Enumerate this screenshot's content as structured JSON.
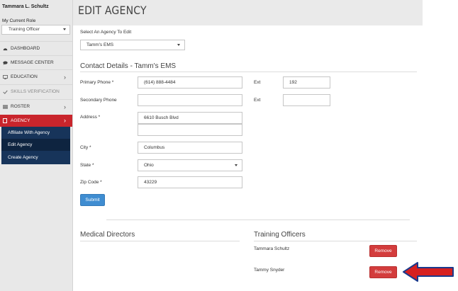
{
  "sidebar": {
    "user_name": "Tammara L. Schultz",
    "role_label": "My Current Role",
    "role_value": "Training Officer",
    "nav": {
      "dashboard": "DASHBOARD",
      "message_center": "MESSAGE CENTER",
      "education": "EDUCATION",
      "skills_verification": "SKILLS VERIFICATION",
      "roster": "ROSTER",
      "agency": "AGENCY"
    },
    "agency_sub": {
      "affiliate": "Affiliate With Agency",
      "edit": "Edit Agency",
      "create": "Create Agency"
    }
  },
  "header": {
    "title": "EDIT AGENCY"
  },
  "agency_select": {
    "label": "Select An Agency To Edit",
    "value": "Tamm's EMS"
  },
  "contact": {
    "title": "Contact Details - Tamm's EMS",
    "primary_phone_label": "Primary Phone *",
    "primary_phone": "(614) 888-4484",
    "ext_label": "Ext",
    "ext_value": "192",
    "secondary_phone_label": "Secondary Phone",
    "secondary_phone": "",
    "secondary_ext": "",
    "address_label": "Address *",
    "address1": "6610 Busch Blvd",
    "address2": "",
    "city_label": "City *",
    "city": "Columbus",
    "state_label": "State *",
    "state": "Ohio",
    "zip_label": "Zip Code *",
    "zip": "43229"
  },
  "submit_label": "Submit",
  "medical_directors": {
    "title": "Medical Directors"
  },
  "training_officers": {
    "title": "Training Officers",
    "people": [
      {
        "name": "Tammara Schultz",
        "action": "Remove"
      },
      {
        "name": "Tammy Snyder",
        "action": "Remove"
      }
    ]
  },
  "colors": {
    "accent_red": "#c9252c",
    "sidebar_navy": "#17345a",
    "primary_blue": "#3f8dd1",
    "remove_red": "#d33c3c",
    "arrow_red": "#d62020",
    "arrow_outline": "#1b3a8c"
  },
  "icons": {
    "dashboard": "dashboard-icon",
    "message": "message-icon",
    "education": "monitor-icon",
    "skills": "check-icon",
    "roster": "list-icon",
    "agency": "building-icon",
    "callout": "arrow-left-icon"
  }
}
